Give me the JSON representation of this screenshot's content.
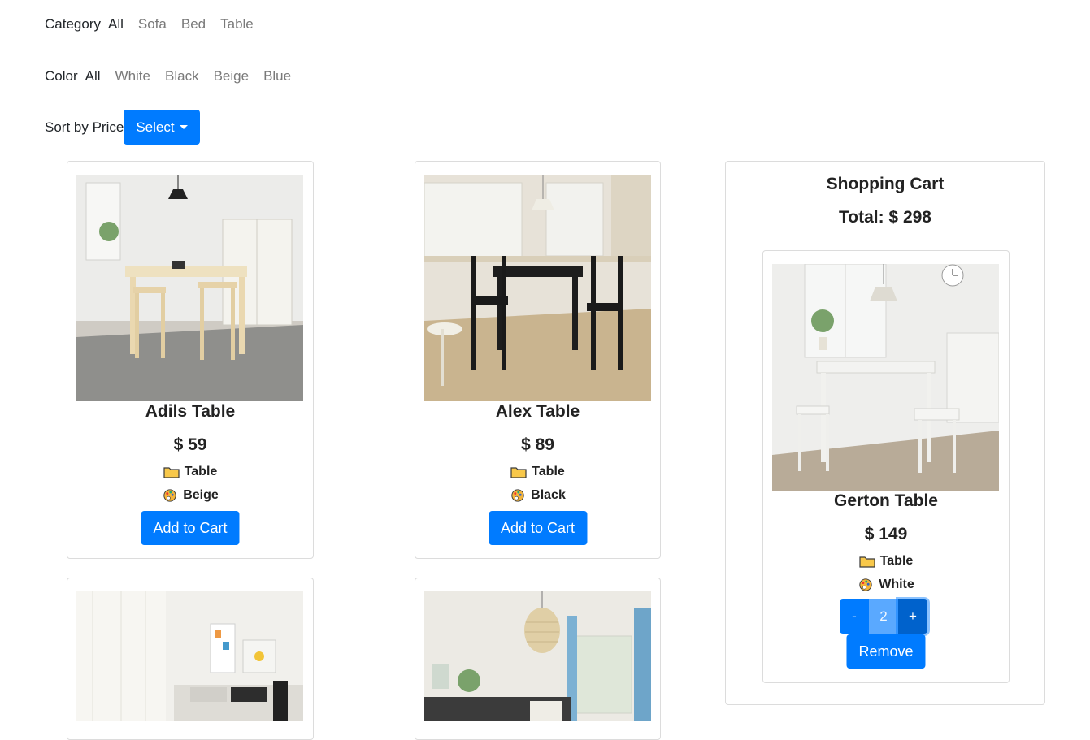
{
  "filters": {
    "category": {
      "label": "Category",
      "options": [
        "All",
        "Sofa",
        "Bed",
        "Table"
      ],
      "active": "All"
    },
    "color": {
      "label": "Color",
      "options": [
        "All",
        "White",
        "Black",
        "Beige",
        "Blue"
      ],
      "active": "All"
    },
    "sort": {
      "label": "Sort by Price",
      "button_label": "Select"
    }
  },
  "products": [
    {
      "name": "Adils Table",
      "price": "$ 59",
      "category": "Table",
      "color": "Beige",
      "button_label": "Add to Cart",
      "category_icon": "folder-icon",
      "color_icon": "palette-icon"
    },
    {
      "name": "Alex Table",
      "price": "$ 89",
      "category": "Table",
      "color": "Black",
      "button_label": "Add to Cart",
      "category_icon": "folder-icon",
      "color_icon": "palette-icon"
    }
  ],
  "cart": {
    "title": "Shopping Cart",
    "total": "Total: $ 298",
    "items": [
      {
        "name": "Gerton Table",
        "price": "$ 149",
        "category": "Table",
        "color": "White",
        "quantity": "2",
        "minus_label": "-",
        "plus_label": "+",
        "remove_label": "Remove"
      }
    ]
  },
  "colors": {
    "primary": "#007bff",
    "primary_dark": "#0062cc",
    "text": "#212529",
    "muted": "#7a7a7a"
  }
}
